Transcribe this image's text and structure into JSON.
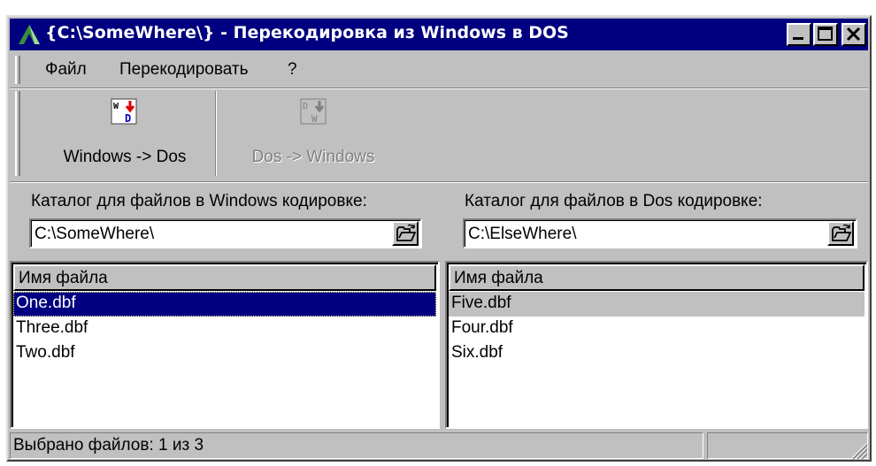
{
  "window": {
    "title": "{C:\\SomeWhere\\} - Перекодировка из Windows в DOS"
  },
  "menu": {
    "items": [
      "Файл",
      "Перекодировать",
      "?"
    ]
  },
  "toolbar": {
    "buttons": [
      {
        "label": "Windows -> Dos",
        "icon": "win-to-dos-icon",
        "enabled": true
      },
      {
        "label": "Dos -> Windows",
        "icon": "dos-to-win-icon",
        "enabled": false
      }
    ]
  },
  "left_panel": {
    "dir_label": "Каталог для файлов в Windows кодировке:",
    "path": "C:\\SomeWhere\\",
    "column_header": "Имя файла",
    "files": [
      "One.dbf",
      "Three.dbf",
      "Two.dbf"
    ],
    "selected_index": 0
  },
  "right_panel": {
    "dir_label": "Каталог для файлов в Dos кодировке:",
    "path": "C:\\ElseWhere\\",
    "column_header": "Имя файла",
    "files": [
      "Five.dbf",
      "Four.dbf",
      "Six.dbf"
    ],
    "selected_index": 0
  },
  "status": {
    "text": "Выбрано файлов: 1 из 3",
    "panel2": ""
  },
  "colors": {
    "title_bar": "#000080",
    "face": "#c0c0c0",
    "selection": "#000080"
  }
}
